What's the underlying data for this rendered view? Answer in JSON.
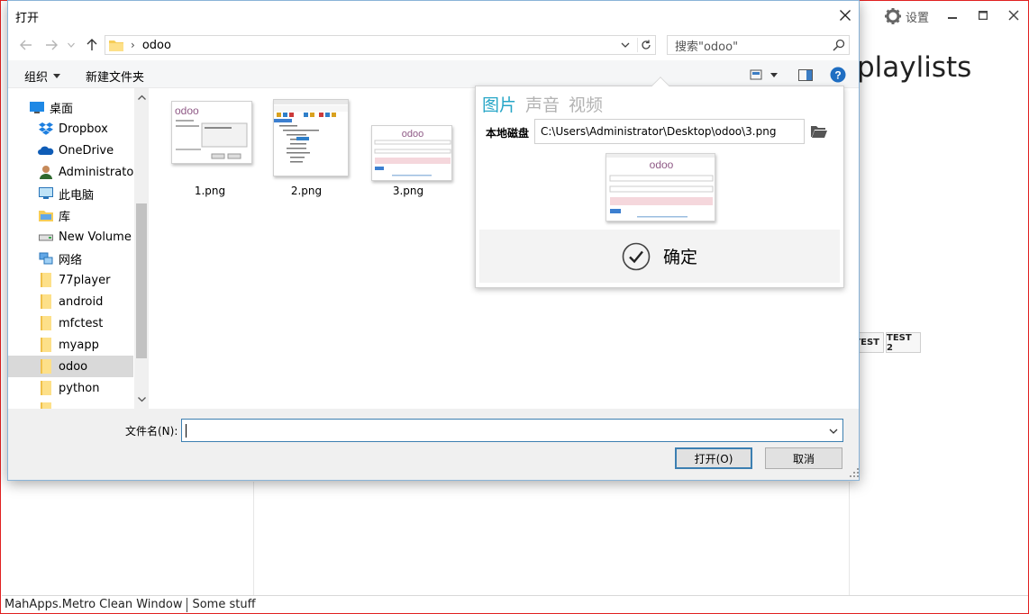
{
  "background_window": {
    "settings_label": "设置",
    "partial_title": "playlists",
    "tags": [
      "TEST",
      "TEST 2"
    ],
    "status_left": "MahApps.Metro Clean Window",
    "status_right": "Some stuff"
  },
  "dialog": {
    "title": "打开",
    "address": {
      "current_folder": "odoo"
    },
    "search": {
      "placeholder": "搜索\"odoo\""
    },
    "toolbar": {
      "organize_label": "组织",
      "new_folder_label": "新建文件夹"
    },
    "nav_items": [
      {
        "label": "桌面",
        "icon": "desktop-icon"
      },
      {
        "label": "Dropbox",
        "icon": "dropbox-icon"
      },
      {
        "label": "OneDrive",
        "icon": "onedrive-icon"
      },
      {
        "label": "Administrator",
        "icon": "user-icon"
      },
      {
        "label": "此电脑",
        "icon": "computer-icon"
      },
      {
        "label": "库",
        "icon": "library-icon"
      },
      {
        "label": "New Volume (E",
        "icon": "drive-icon"
      },
      {
        "label": "网络",
        "icon": "network-icon"
      },
      {
        "label": "77player",
        "icon": "folder-icon"
      },
      {
        "label": "android",
        "icon": "folder-icon"
      },
      {
        "label": "mfctest",
        "icon": "folder-icon"
      },
      {
        "label": "myapp",
        "icon": "folder-icon"
      },
      {
        "label": "odoo",
        "icon": "folder-icon",
        "selected": true
      },
      {
        "label": "python",
        "icon": "folder-icon"
      }
    ],
    "files": [
      {
        "name": "1.png"
      },
      {
        "name": "2.png"
      },
      {
        "name": "3.png"
      }
    ],
    "filename_label": "文件名(N):",
    "filename_value": "",
    "open_button": "打开(O)",
    "cancel_button": "取消"
  },
  "media_picker": {
    "tabs": [
      {
        "label": "图片",
        "active": true
      },
      {
        "label": "声音",
        "active": false
      },
      {
        "label": "视频",
        "active": false
      }
    ],
    "location_label": "本地磁盘",
    "path_value": "C:\\Users\\Administrator\\Desktop\\odoo\\3.png",
    "confirm_label": "确定",
    "accent_color": "#27a6c7"
  }
}
